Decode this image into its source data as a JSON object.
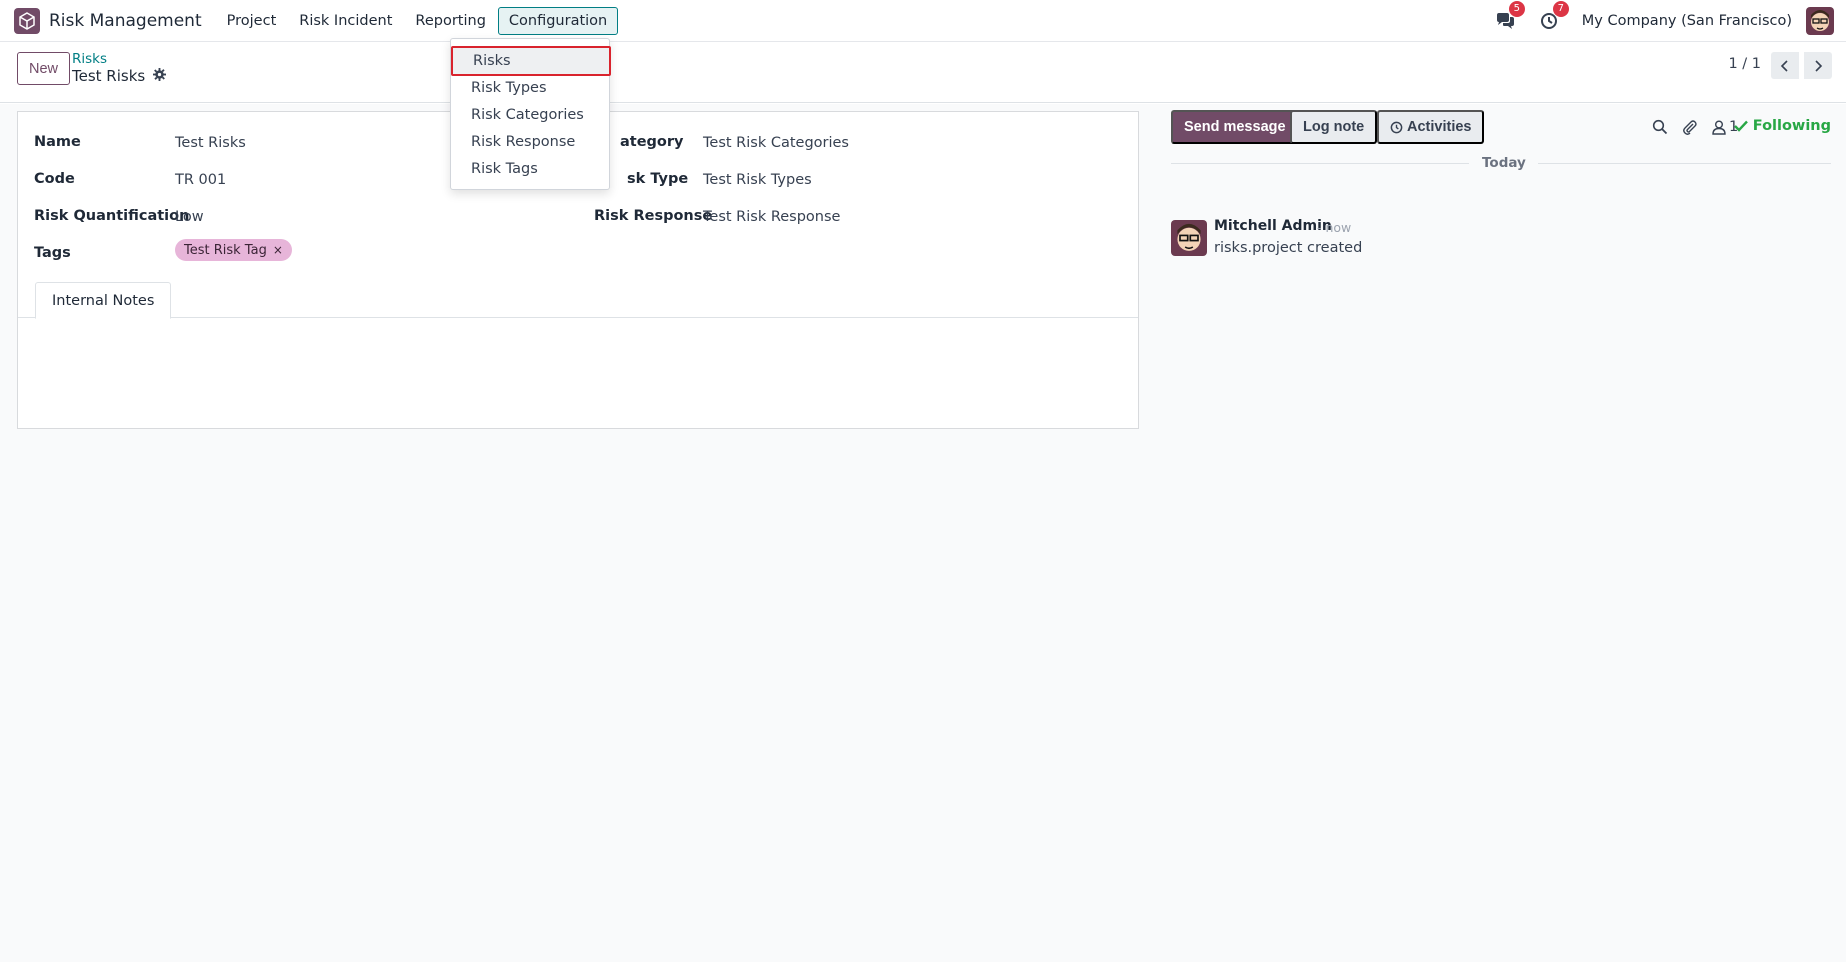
{
  "app": {
    "name": "Risk Management",
    "logo_icon": "box-icon",
    "accent": "#714B67",
    "link_color": "#017e84"
  },
  "menu": {
    "items": [
      "Project",
      "Risk Incident",
      "Reporting",
      "Configuration"
    ],
    "active": "Configuration"
  },
  "systray": {
    "messages_badge": "5",
    "activities_badge": "7",
    "company": "My Company (San Francisco)"
  },
  "control_panel": {
    "new_label": "New",
    "breadcrumb": "Risks",
    "record_title": "Test Risks",
    "pager": "1 / 1"
  },
  "form": {
    "labels": {
      "name": "Name",
      "code": "Code",
      "risk_quantification": "Risk Quantification",
      "tags": "Tags",
      "category": "ategory",
      "risk_type": "sk Type",
      "risk_response": "Risk Response"
    },
    "values": {
      "name": "Test Risks",
      "code": "TR 001",
      "risk_quantification": "Low",
      "category": "Test Risk Categories",
      "risk_type": "Test Risk Types",
      "risk_response": "Test Risk Response"
    },
    "tags": [
      "Test Risk Tag"
    ],
    "tag_remove": "×",
    "tag_color": "#e7b5d9",
    "tabs": [
      "Internal Notes"
    ]
  },
  "chatter": {
    "send_message": "Send message",
    "log_note": "Log note",
    "activities": "Activities",
    "followers_count": "1",
    "following": "Following",
    "date_separator": "Today",
    "messages": [
      {
        "author": "Mitchell Admin",
        "time": "- now",
        "body": "risks.project created"
      }
    ]
  },
  "dropdown": {
    "items": [
      "Risks",
      "Risk Types",
      "Risk Categories",
      "Risk Response",
      "Risk Tags"
    ],
    "highlighted": "Risks"
  }
}
